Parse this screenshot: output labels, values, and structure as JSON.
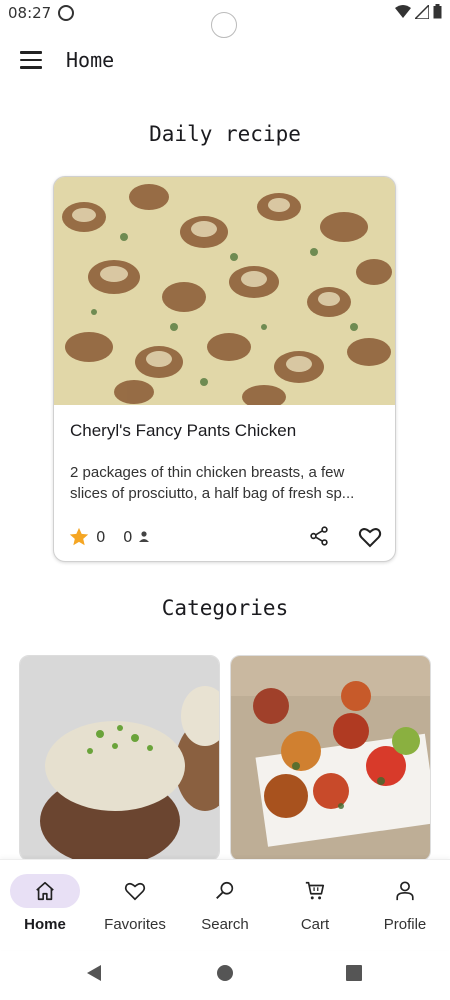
{
  "status": {
    "time": "08:27"
  },
  "app_bar": {
    "title": "Home",
    "menu_icon": "hamburger-menu-icon"
  },
  "daily": {
    "heading": "Daily recipe",
    "recipe": {
      "title": "Cheryl's Fancy Pants Chicken",
      "description_line1": "2 packages of thin chicken breasts, a few",
      "description_line2": "slices of prosciutto, a half bag of fresh sp...",
      "rating": "0",
      "users": "0",
      "star_color": "#f5a623"
    }
  },
  "categories": {
    "heading": "Categories"
  },
  "bottom_nav": {
    "active_color": "#e8e0f5",
    "items": [
      {
        "label": "Home",
        "icon": "home-icon"
      },
      {
        "label": "Favorites",
        "icon": "heart-outline-icon"
      },
      {
        "label": "Search",
        "icon": "search-icon"
      },
      {
        "label": "Cart",
        "icon": "cart-icon"
      },
      {
        "label": "Profile",
        "icon": "person-icon"
      }
    ]
  }
}
